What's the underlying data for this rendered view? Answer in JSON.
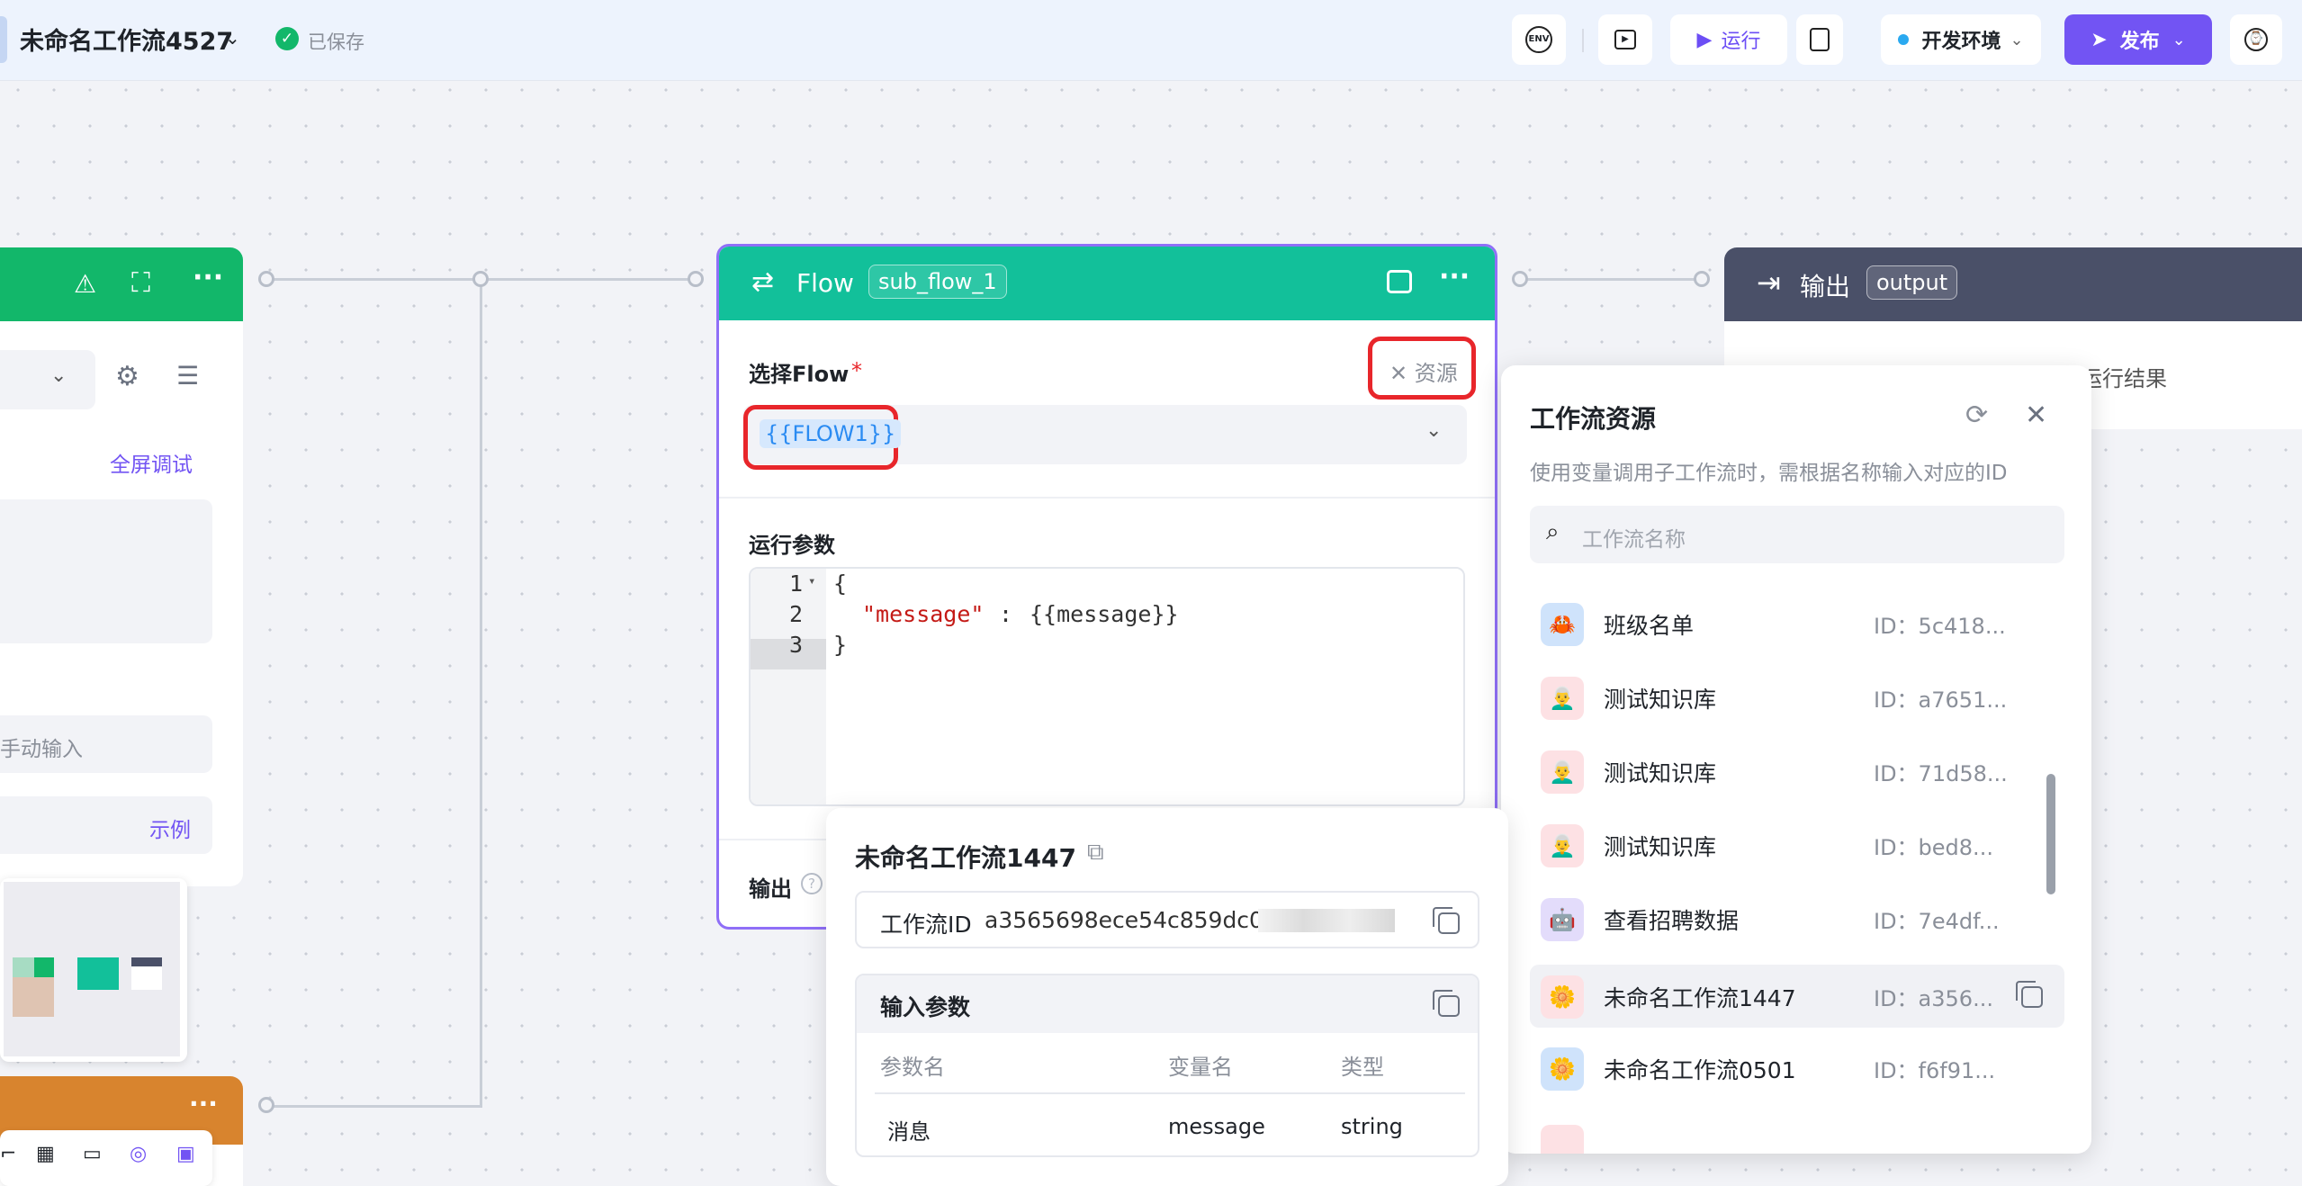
{
  "header": {
    "title": "未命名工作流4527",
    "saved": "已保存",
    "env_label": "ENV",
    "run_label": "运行",
    "env_select": "开发环境",
    "publish_label": "发布"
  },
  "left_node": {
    "fullscreen_debug": "全屏调试",
    "manual_input_placeholder": "手动输入",
    "example": "示例"
  },
  "flow_node": {
    "title": "Flow",
    "tag": "sub_flow_1",
    "select_label": "选择Flow",
    "required": "*",
    "resource_btn": "资源",
    "selected_value": "{{FLOW1}}",
    "params_label": "运行参数",
    "code": {
      "line_numbers": [
        "1",
        "2",
        "3"
      ],
      "open_brace": "{",
      "key": "\"message\"",
      "colon": ":",
      "value": "{{message}}",
      "close_brace": "}"
    },
    "output_label": "输出"
  },
  "output_node": {
    "title": "输出",
    "tag": "output",
    "hint": "运行结果"
  },
  "popover": {
    "title": "未命名工作流1447",
    "id_label": "工作流ID",
    "id_value": "a3565698ece54c859dc0c",
    "inputs_title": "输入参数",
    "columns": [
      "参数名",
      "变量名",
      "类型"
    ],
    "rows": [
      {
        "param": "消息",
        "var": "message",
        "type": "string"
      }
    ]
  },
  "resource_panel": {
    "title": "工作流资源",
    "subtitle": "使用变量调用子工作流时，需根据名称输入对应的ID",
    "search_placeholder": "工作流名称",
    "items": [
      {
        "name": "班级名单",
        "id": "ID：5c418...",
        "avatar": "🦀",
        "bg": "#cfe3fb"
      },
      {
        "name": "测试知识库",
        "id": "ID：a7651...",
        "avatar": "👨‍🦳",
        "bg": "#fde1e4"
      },
      {
        "name": "测试知识库",
        "id": "ID：71d58...",
        "avatar": "👨‍🦳",
        "bg": "#fde1e4"
      },
      {
        "name": "测试知识库",
        "id": "ID：bed8...",
        "avatar": "👨‍🦳",
        "bg": "#fde1e4"
      },
      {
        "name": "查看招聘数据",
        "id": "ID：7e4df...",
        "avatar": "🤖",
        "bg": "#e3dcfb"
      },
      {
        "name": "未命名工作流1447",
        "id": "ID：a356...",
        "avatar": "🌼",
        "bg": "#fde1e4"
      },
      {
        "name": "未命名工作流0501",
        "id": "ID：f6f91...",
        "avatar": "🌼",
        "bg": "#cfe3fb"
      }
    ]
  }
}
